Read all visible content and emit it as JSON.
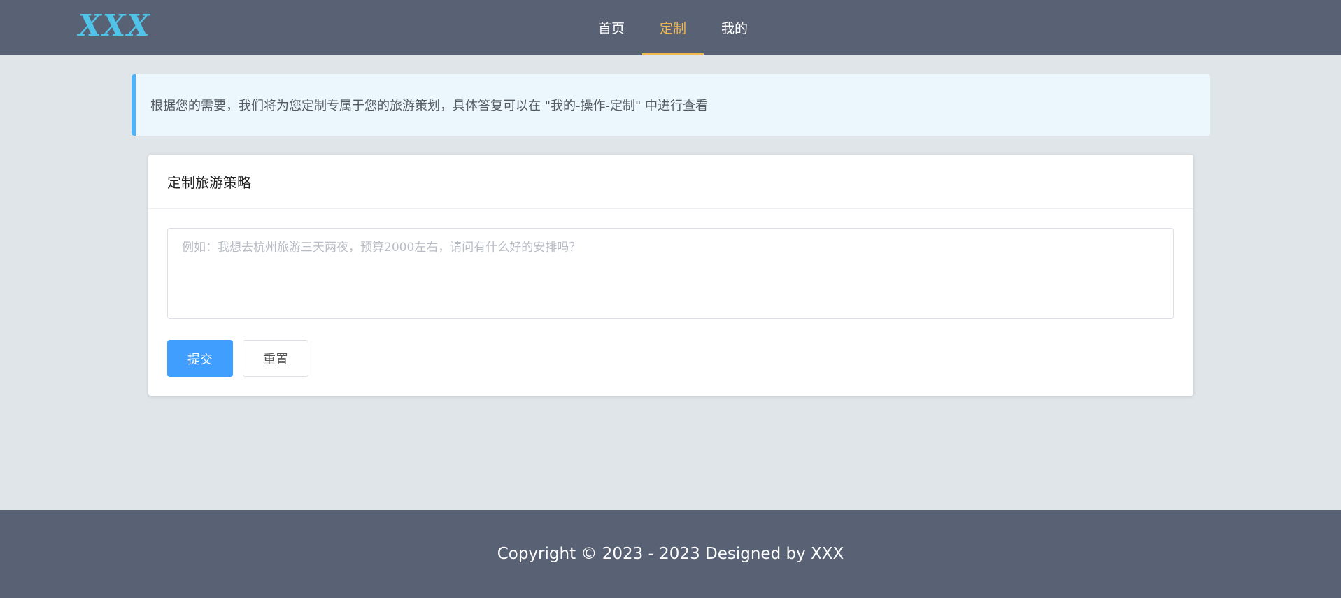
{
  "brand": {
    "logo_text": "XXX",
    "logo_color": "#4fc3e8"
  },
  "nav": {
    "items": [
      {
        "label": "首页",
        "active": false
      },
      {
        "label": "定制",
        "active": true
      },
      {
        "label": "我的",
        "active": false
      }
    ],
    "active_color": "#f2b94f",
    "text_color": "#ffffff"
  },
  "notice": {
    "text": "根据您的需要，我们将为您定制专属于您的旅游策划，具体答复可以在 \"我的-操作-定制\" 中进行查看"
  },
  "card": {
    "title": "定制旅游策略",
    "textarea": {
      "value": "",
      "placeholder": "例如：我想去杭州旅游三天两夜，预算2000左右，请问有什么好的安排吗？"
    },
    "submit_label": "提交",
    "reset_label": "重置"
  },
  "footer": {
    "copyright": "Copyright © 2023 - 2023 Designed by XXX"
  },
  "colors": {
    "header_bg": "#596174",
    "page_bg": "#dfe5e9",
    "notice_bg": "#ebf6fd",
    "notice_accent": "#4eb4f6",
    "primary": "#409eff"
  }
}
